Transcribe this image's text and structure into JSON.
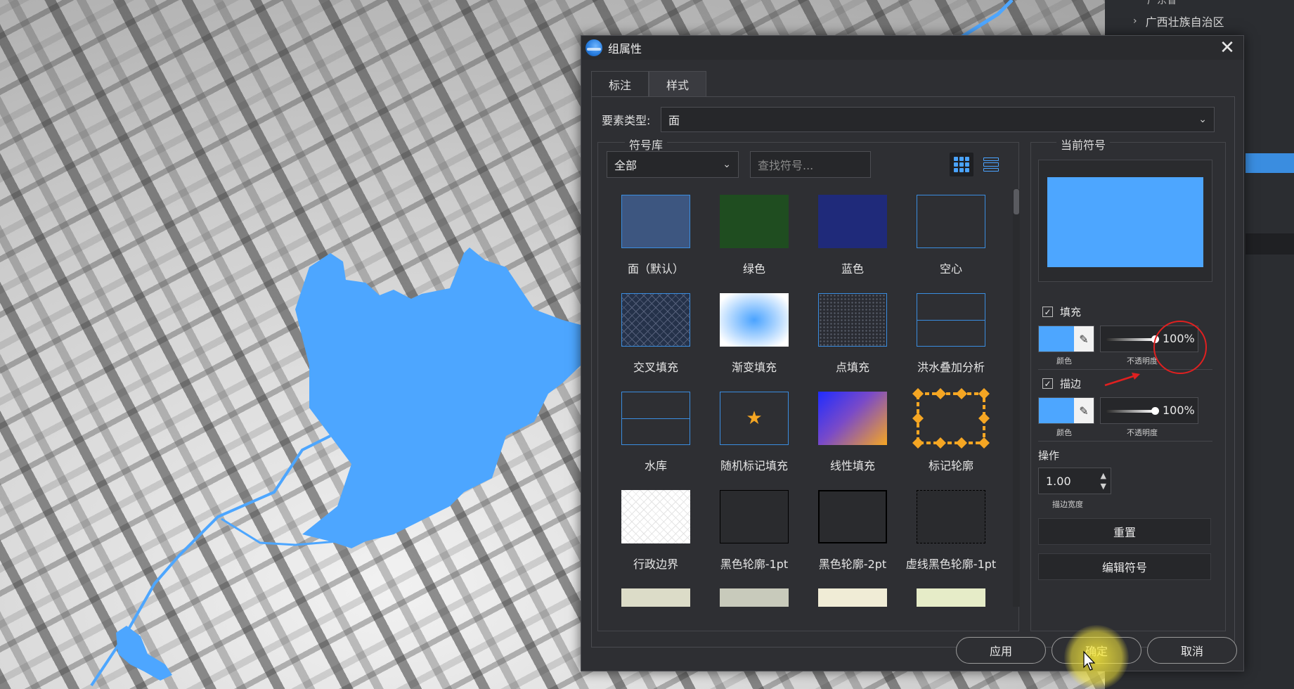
{
  "side_panel": {
    "partial_item": "广东省",
    "tree_item": "广西壮族自治区"
  },
  "dialog": {
    "title": "组属性",
    "close_glyph": "✕",
    "tabs": [
      {
        "label": "标注",
        "active": false
      },
      {
        "label": "样式",
        "active": true
      }
    ],
    "feature_type": {
      "label": "要素类型:",
      "value": "面"
    },
    "library": {
      "title": "符号库",
      "filter_value": "全部",
      "search_placeholder": "查找符号...",
      "symbols": [
        {
          "name": "面（默认）",
          "icon": "solid-fill-swatch",
          "color": "#3d5680"
        },
        {
          "name": "绿色",
          "icon": "solid-fill-swatch",
          "color": "#1f4d20"
        },
        {
          "name": "蓝色",
          "icon": "solid-fill-swatch",
          "color": "#1f2a7a"
        },
        {
          "name": "空心",
          "icon": "hollow-fill-swatch",
          "color": "#3a8de0"
        },
        {
          "name": "交叉填充",
          "icon": "cross-hatch-swatch",
          "color": "#3a8de0"
        },
        {
          "name": "渐变填充",
          "icon": "gradient-fill-swatch",
          "color": "#4aa3ff"
        },
        {
          "name": "点填充",
          "icon": "dot-fill-swatch",
          "color": "#3a8de0"
        },
        {
          "name": "洪水叠加分析",
          "icon": "split-outline-swatch",
          "color": "#3a8de0"
        },
        {
          "name": "水库",
          "icon": "split-outline-swatch",
          "color": "#3a8de0"
        },
        {
          "name": "随机标记填充",
          "icon": "star-marker-swatch",
          "color": "#f5a623"
        },
        {
          "name": "线性填充",
          "icon": "linear-gradient-swatch",
          "color": "#f5a623"
        },
        {
          "name": "标记轮廓",
          "icon": "marker-outline-swatch",
          "color": "#f5a623"
        },
        {
          "name": "行政边界",
          "icon": "white-hatch-swatch",
          "color": "#ffffff"
        },
        {
          "name": "黑色轮廓-1pt",
          "icon": "black-outline-swatch",
          "color": "#000000"
        },
        {
          "name": "黑色轮廓-2pt",
          "icon": "black-outline-swatch",
          "color": "#000000"
        },
        {
          "name": "虚线黑色轮廓-1pt",
          "icon": "dashed-outline-swatch",
          "color": "#000000"
        }
      ],
      "partial_row_colors": [
        "#dcdcc8",
        "#c8cabb",
        "#f0ecd6",
        "#e6ecc8"
      ]
    },
    "current_symbol": {
      "title": "当前符号",
      "preview_color": "#4da6ff",
      "fill": {
        "label": "填充",
        "checked": true,
        "color": "#4da6ff",
        "color_caption": "颜色",
        "opacity": 1.0,
        "opacity_text": "100%",
        "opacity_caption": "不透明度"
      },
      "stroke": {
        "label": "描边",
        "checked": true,
        "color": "#4da6ff",
        "color_caption": "颜色",
        "opacity": 1.0,
        "opacity_text": "100%",
        "opacity_caption": "不透明度"
      },
      "ops": {
        "label": "操作",
        "stroke_width": "1.00",
        "stroke_width_caption": "描边宽度"
      },
      "reset_label": "重置",
      "edit_label": "编辑符号"
    },
    "footer": {
      "apply_label": "应用",
      "ok_label": "确定",
      "cancel_label": "取消"
    }
  },
  "map": {
    "water_color": "#4da6ff"
  }
}
